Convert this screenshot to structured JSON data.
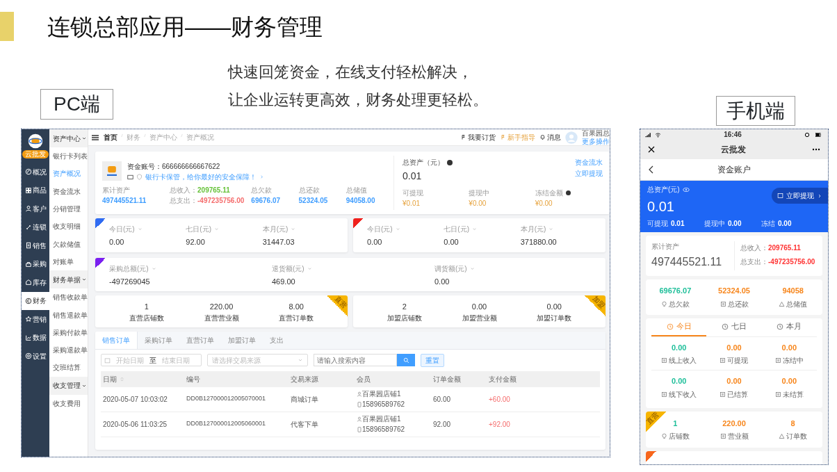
{
  "slide": {
    "title": "连锁总部应用——财务管理",
    "subtitle_lines": [
      "快速回笼资金，在线支付轻松解决，",
      "让企业运转更高效，财务处理更轻松。"
    ],
    "pc_label": "PC端",
    "mobile_label": "手机端"
  },
  "pc": {
    "brand": "云批发",
    "nav": [
      {
        "label": "概况",
        "selected": false
      },
      {
        "label": "商品",
        "selected": false
      },
      {
        "label": "客户",
        "selected": false
      },
      {
        "label": "连锁",
        "selected": false
      },
      {
        "label": "销售",
        "selected": false
      },
      {
        "label": "采购",
        "selected": false
      },
      {
        "label": "库存",
        "selected": false
      },
      {
        "label": "财务",
        "selected": true
      },
      {
        "label": "营销",
        "selected": false
      },
      {
        "label": "数据",
        "selected": false
      },
      {
        "label": "设置",
        "selected": false
      }
    ],
    "subnav": [
      {
        "label": "资产中心",
        "expanded": true,
        "children": [
          {
            "label": "银行卡列表",
            "selected": false
          },
          {
            "label": "资产概况",
            "selected": true
          },
          {
            "label": "资金流水",
            "selected": false
          },
          {
            "label": "分销管理",
            "selected": false
          },
          {
            "label": "收支明细",
            "selected": false
          },
          {
            "label": "欠款储值",
            "selected": false
          },
          {
            "label": "对账单",
            "selected": false
          }
        ]
      },
      {
        "label": "财务单据",
        "expanded": true,
        "children": [
          {
            "label": "销售收款单",
            "selected": false
          },
          {
            "label": "销售退款单",
            "selected": false
          },
          {
            "label": "采购付款单",
            "selected": false
          },
          {
            "label": "采购退款单",
            "selected": false
          },
          {
            "label": "交班结算",
            "selected": false
          }
        ]
      },
      {
        "label": "收支管理",
        "expanded": true,
        "children": [
          {
            "label": "收支费用",
            "selected": false
          }
        ]
      }
    ],
    "breadcrumb": [
      "首页",
      "财务",
      "资产中心",
      "资产概况"
    ],
    "top_links": [
      {
        "label": "我要订货",
        "highlighted": false
      },
      {
        "label": "新手指导",
        "highlighted": true
      },
      {
        "label": "消息",
        "highlighted": false
      }
    ],
    "user": {
      "name": "百果园总",
      "menu": "更多操作"
    },
    "account": {
      "text": "资金账号：666666666667622",
      "tip": "银行卡保管，给你最好的安全保障！"
    },
    "assets": {
      "label": "累计资产",
      "value": "497445521.11",
      "income_label": "总收入：",
      "income": "209765.11",
      "expense_label": "总支出：",
      "expense": "-497235756.00"
    },
    "totals": [
      {
        "label": "总欠款",
        "value": "69676.07"
      },
      {
        "label": "总还款",
        "value": "52324.05"
      },
      {
        "label": "总储值",
        "value": "94058.00"
      }
    ],
    "balance": {
      "label": "总资产（元）",
      "value": "0.01",
      "links": [
        "资金流水",
        "立即提现"
      ],
      "items": [
        {
          "label": "可提现",
          "value": "¥0.01",
          "info": false
        },
        {
          "label": "提现中",
          "value": "¥0.00",
          "info": false
        },
        {
          "label": "冻结金额",
          "value": "¥0.00",
          "info": true
        }
      ]
    },
    "period_cards": [
      {
        "color": "#2f6bf2",
        "items": [
          {
            "label": "今日(元)",
            "value": "0.00"
          },
          {
            "label": "七日(元)",
            "value": "92.00"
          },
          {
            "label": "本月(元)",
            "value": "31447.03"
          }
        ]
      },
      {
        "color": "#f0201c",
        "items": [
          {
            "label": "今日(元)",
            "value": "0.00"
          },
          {
            "label": "七日(元)",
            "value": "0.00"
          },
          {
            "label": "本月(元)",
            "value": "371880.00"
          }
        ]
      },
      {
        "color": "#7a1ff0",
        "items": [
          {
            "label": "采购总额(元)",
            "value": "-497269045"
          },
          {
            "label": "退货额(元)",
            "value": "469.00"
          },
          {
            "label": "调货额(元)",
            "value": "0.00"
          }
        ]
      }
    ],
    "store_cards": [
      {
        "ribbon": "直营",
        "items": [
          {
            "label": "直营店铺数",
            "value": "1"
          },
          {
            "label": "直营营业额",
            "value": "220.00"
          },
          {
            "label": "直营订单数",
            "value": "8.00"
          }
        ]
      },
      {
        "ribbon": "加盟",
        "items": [
          {
            "label": "加盟店铺数",
            "value": "2"
          },
          {
            "label": "加盟营业额",
            "value": "0.00"
          },
          {
            "label": "加盟订单数",
            "value": "0.00"
          }
        ]
      }
    ],
    "tabs": [
      {
        "label": "销售订单",
        "selected": true
      },
      {
        "label": "采购订单",
        "selected": false
      },
      {
        "label": "直营订单",
        "selected": false
      },
      {
        "label": "加盟订单",
        "selected": false
      },
      {
        "label": "支出",
        "selected": false
      }
    ],
    "filters": {
      "start_placeholder": "开始日期",
      "separator": "至",
      "end_placeholder": "结束日期",
      "source_placeholder": "请选择交易来源",
      "search_placeholder": "请输入搜索内容",
      "reset": "重置"
    },
    "table": {
      "columns": [
        "日期",
        "编号",
        "交易来源",
        "会员",
        "订单金额",
        "支付金额"
      ],
      "rows": [
        {
          "date": "2020-05-07 10:03:02",
          "number": "DD0B127000012005070001",
          "source": "商城订单",
          "member": "百果园店铺1",
          "phone": "15896589762",
          "amount": "60.00",
          "paid": "+60.00"
        },
        {
          "date": "2020-05-06 11:03:25",
          "number": "DD0B127000012005060001",
          "source": "代客下单",
          "member": "百果园店铺1",
          "phone": "15896589762",
          "amount": "92.00",
          "paid": "+92.00"
        }
      ]
    }
  },
  "mobile": {
    "time": "16:46",
    "app_title": "云批发",
    "page_title": "资金账户",
    "balance": {
      "label": "总资产(元)",
      "value": "0.01",
      "button": "立即提现",
      "items": [
        {
          "label": "可提现",
          "value": "0.01"
        },
        {
          "label": "提现中",
          "value": "0.00"
        },
        {
          "label": "冻结",
          "value": "0.00"
        }
      ]
    },
    "assets": {
      "label": "累计资产",
      "value": "497445521.11",
      "income_label": "总收入：",
      "income": "209765.11",
      "expense_label": "总支出：",
      "expense": "-497235756.00"
    },
    "totals": [
      {
        "label": "总欠款",
        "value": "69676.07",
        "color": "#1fbf9a"
      },
      {
        "label": "总还款",
        "value": "52324.05",
        "color": "#f7861c"
      },
      {
        "label": "总储值",
        "value": "94058",
        "color": "#f7861c"
      }
    ],
    "tabs": [
      {
        "label": "今日",
        "selected": true
      },
      {
        "label": "七日",
        "selected": false
      },
      {
        "label": "本月",
        "selected": false
      }
    ],
    "period_grid": [
      [
        {
          "label": "线上收入",
          "value": "0.00",
          "color": "#1fbf9a"
        },
        {
          "label": "可提现",
          "value": "0.00",
          "color": "#f7861c"
        },
        {
          "label": "冻结中",
          "value": "0.00",
          "color": "#f7861c"
        }
      ],
      [
        {
          "label": "线下收入",
          "value": "0.00",
          "color": "#1fbf9a"
        },
        {
          "label": "已结算",
          "value": "0.00",
          "color": "#f7861c"
        },
        {
          "label": "未结算",
          "value": "0.00",
          "color": "#f7861c"
        }
      ]
    ],
    "store_card": {
      "ribbon": "直营",
      "items": [
        {
          "label": "店铺数",
          "value": "1",
          "color": "#1fbf9a"
        },
        {
          "label": "营业额",
          "value": "220.00",
          "color": "#f7861c"
        },
        {
          "label": "订单数",
          "value": "8",
          "color": "#f7861c"
        }
      ]
    }
  }
}
